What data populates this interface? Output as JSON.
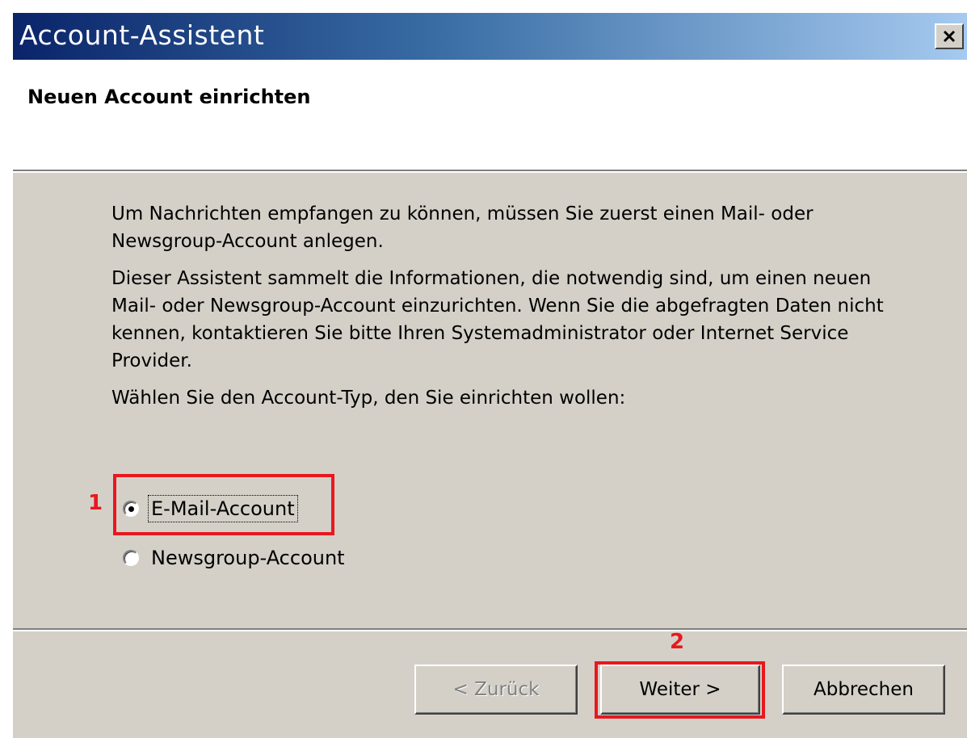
{
  "window": {
    "title": "Account-Assistent",
    "close_icon": "close-icon"
  },
  "header": {
    "title": "Neuen Account einrichten"
  },
  "content": {
    "intro": "Um Nachrichten empfangen zu können, müssen Sie zuerst einen Mail- oder Newsgroup-Account anlegen.",
    "description": "Dieser Assistent sammelt die Informationen, die notwendig sind, um einen neuen Mail- oder Newsgroup-Account einzurichten. Wenn Sie die abgefragten Daten nicht kennen, kontaktieren Sie bitte Ihren Systemadministrator oder Internet Service Provider.",
    "prompt": "Wählen Sie den Account-Typ, den Sie einrichten wollen:"
  },
  "account_types": [
    {
      "label": "E-Mail-Account",
      "selected": true
    },
    {
      "label": "Newsgroup-Account",
      "selected": false
    }
  ],
  "buttons": {
    "back": "< Zurück",
    "back_enabled": false,
    "next": "Weiter >",
    "cancel": "Abbrechen"
  },
  "annotations": {
    "step1": "1",
    "step2": "2",
    "color": "#e8181e"
  }
}
